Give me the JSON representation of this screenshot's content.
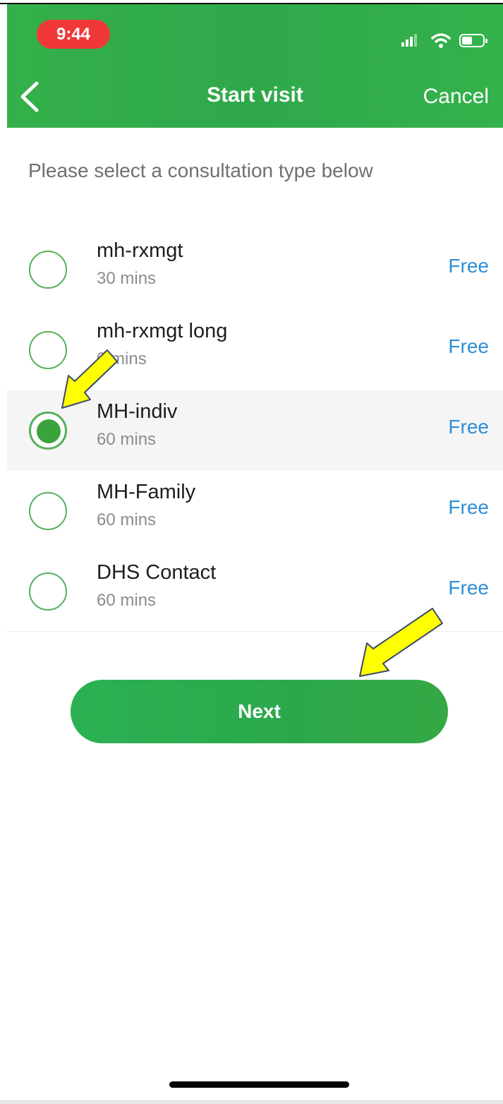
{
  "status_bar": {
    "time": "9:44"
  },
  "nav": {
    "title": "Start visit",
    "cancel_label": "Cancel",
    "back_icon": "chevron-left-icon"
  },
  "prompt": "Please select a consultation type below",
  "options": [
    {
      "name": "mh-rxmgt",
      "duration": "30 mins",
      "price": "Free",
      "selected": false
    },
    {
      "name": "mh-rxmgt long",
      "duration": "0 mins",
      "price": "Free",
      "selected": false
    },
    {
      "name": "MH-indiv",
      "duration": "60 mins",
      "price": "Free",
      "selected": true
    },
    {
      "name": "MH-Family",
      "duration": "60 mins",
      "price": "Free",
      "selected": false
    },
    {
      "name": "DHS Contact",
      "duration": "60 mins",
      "price": "Free",
      "selected": false
    }
  ],
  "next_label": "Next",
  "colors": {
    "header_green": "#2fa84a",
    "time_pill_red": "#f13838",
    "price_blue": "#2e8fd6",
    "radio_green": "#3aa33c",
    "annotation_arrow": "#ffff00"
  }
}
